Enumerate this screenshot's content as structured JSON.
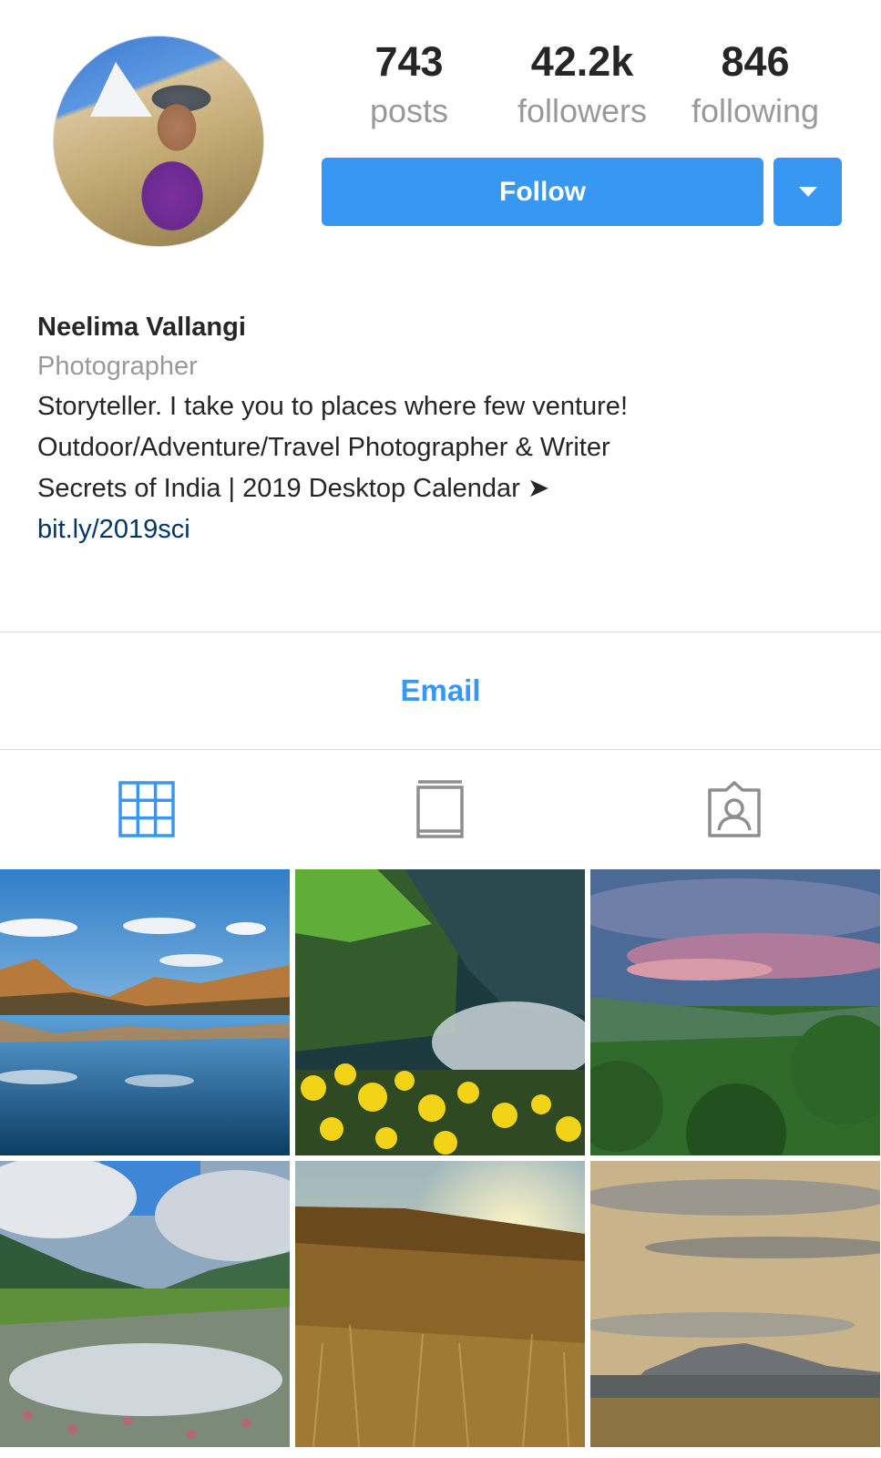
{
  "profile": {
    "avatar_alt": "profile photo",
    "stats": [
      {
        "value": "743",
        "label": "posts"
      },
      {
        "value": "42.2k",
        "label": "followers"
      },
      {
        "value": "846",
        "label": "following"
      }
    ],
    "follow_label": "Follow",
    "name": "Neelima Vallangi",
    "category": "Photographer",
    "bio_lines": [
      "Storyteller. I take you to places where few venture!",
      "Outdoor/Adventure/Travel Photographer & Writer",
      "Secrets of India | 2019 Desktop Calendar ➤"
    ],
    "link": "bit.ly/2019sci"
  },
  "contact": {
    "email_label": "Email"
  },
  "tabs": [
    {
      "icon": "grid-icon",
      "active": true
    },
    {
      "icon": "feed-icon",
      "active": false
    },
    {
      "icon": "tagged-icon",
      "active": false
    }
  ],
  "colors": {
    "accent": "#3897f0",
    "link": "#003569",
    "muted": "#999999",
    "text": "#262626",
    "divider": "#dbdbdb"
  }
}
